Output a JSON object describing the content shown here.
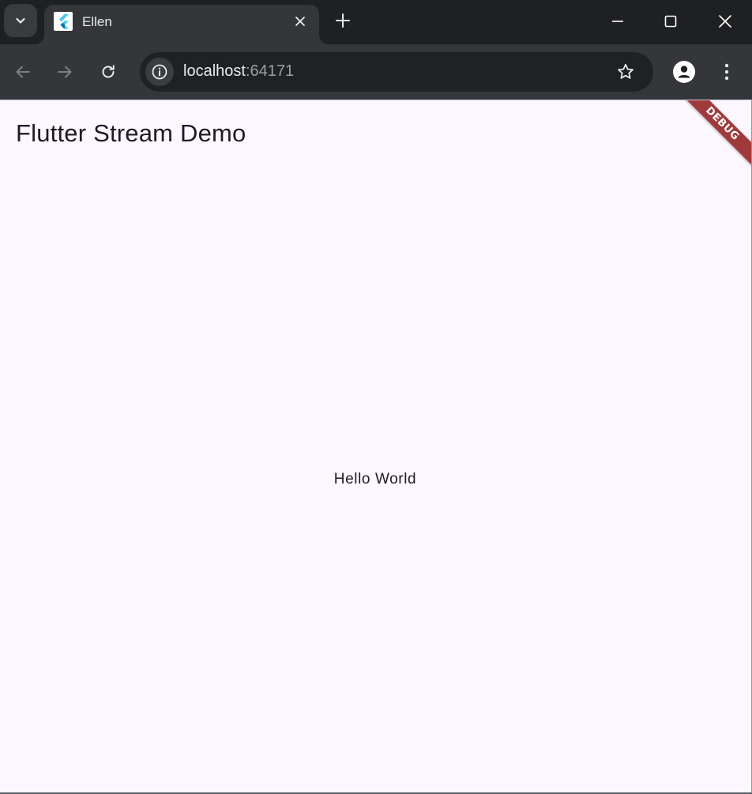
{
  "browser": {
    "tab": {
      "title": "Ellen",
      "favicon": "flutter-logo-icon"
    },
    "toolbar": {
      "url_host": "localhost",
      "url_port": ":64171"
    },
    "colors": {
      "tabstrip": "#1f2022",
      "toolbar": "#35363a",
      "omnibox": "#202124"
    }
  },
  "app": {
    "title": "Flutter Stream Demo",
    "body_text": "Hello World",
    "debug_banner": "DEBUG",
    "colors": {
      "background": "#fdf7ff",
      "text": "#1d1b20",
      "banner": "#a03a3a"
    }
  }
}
